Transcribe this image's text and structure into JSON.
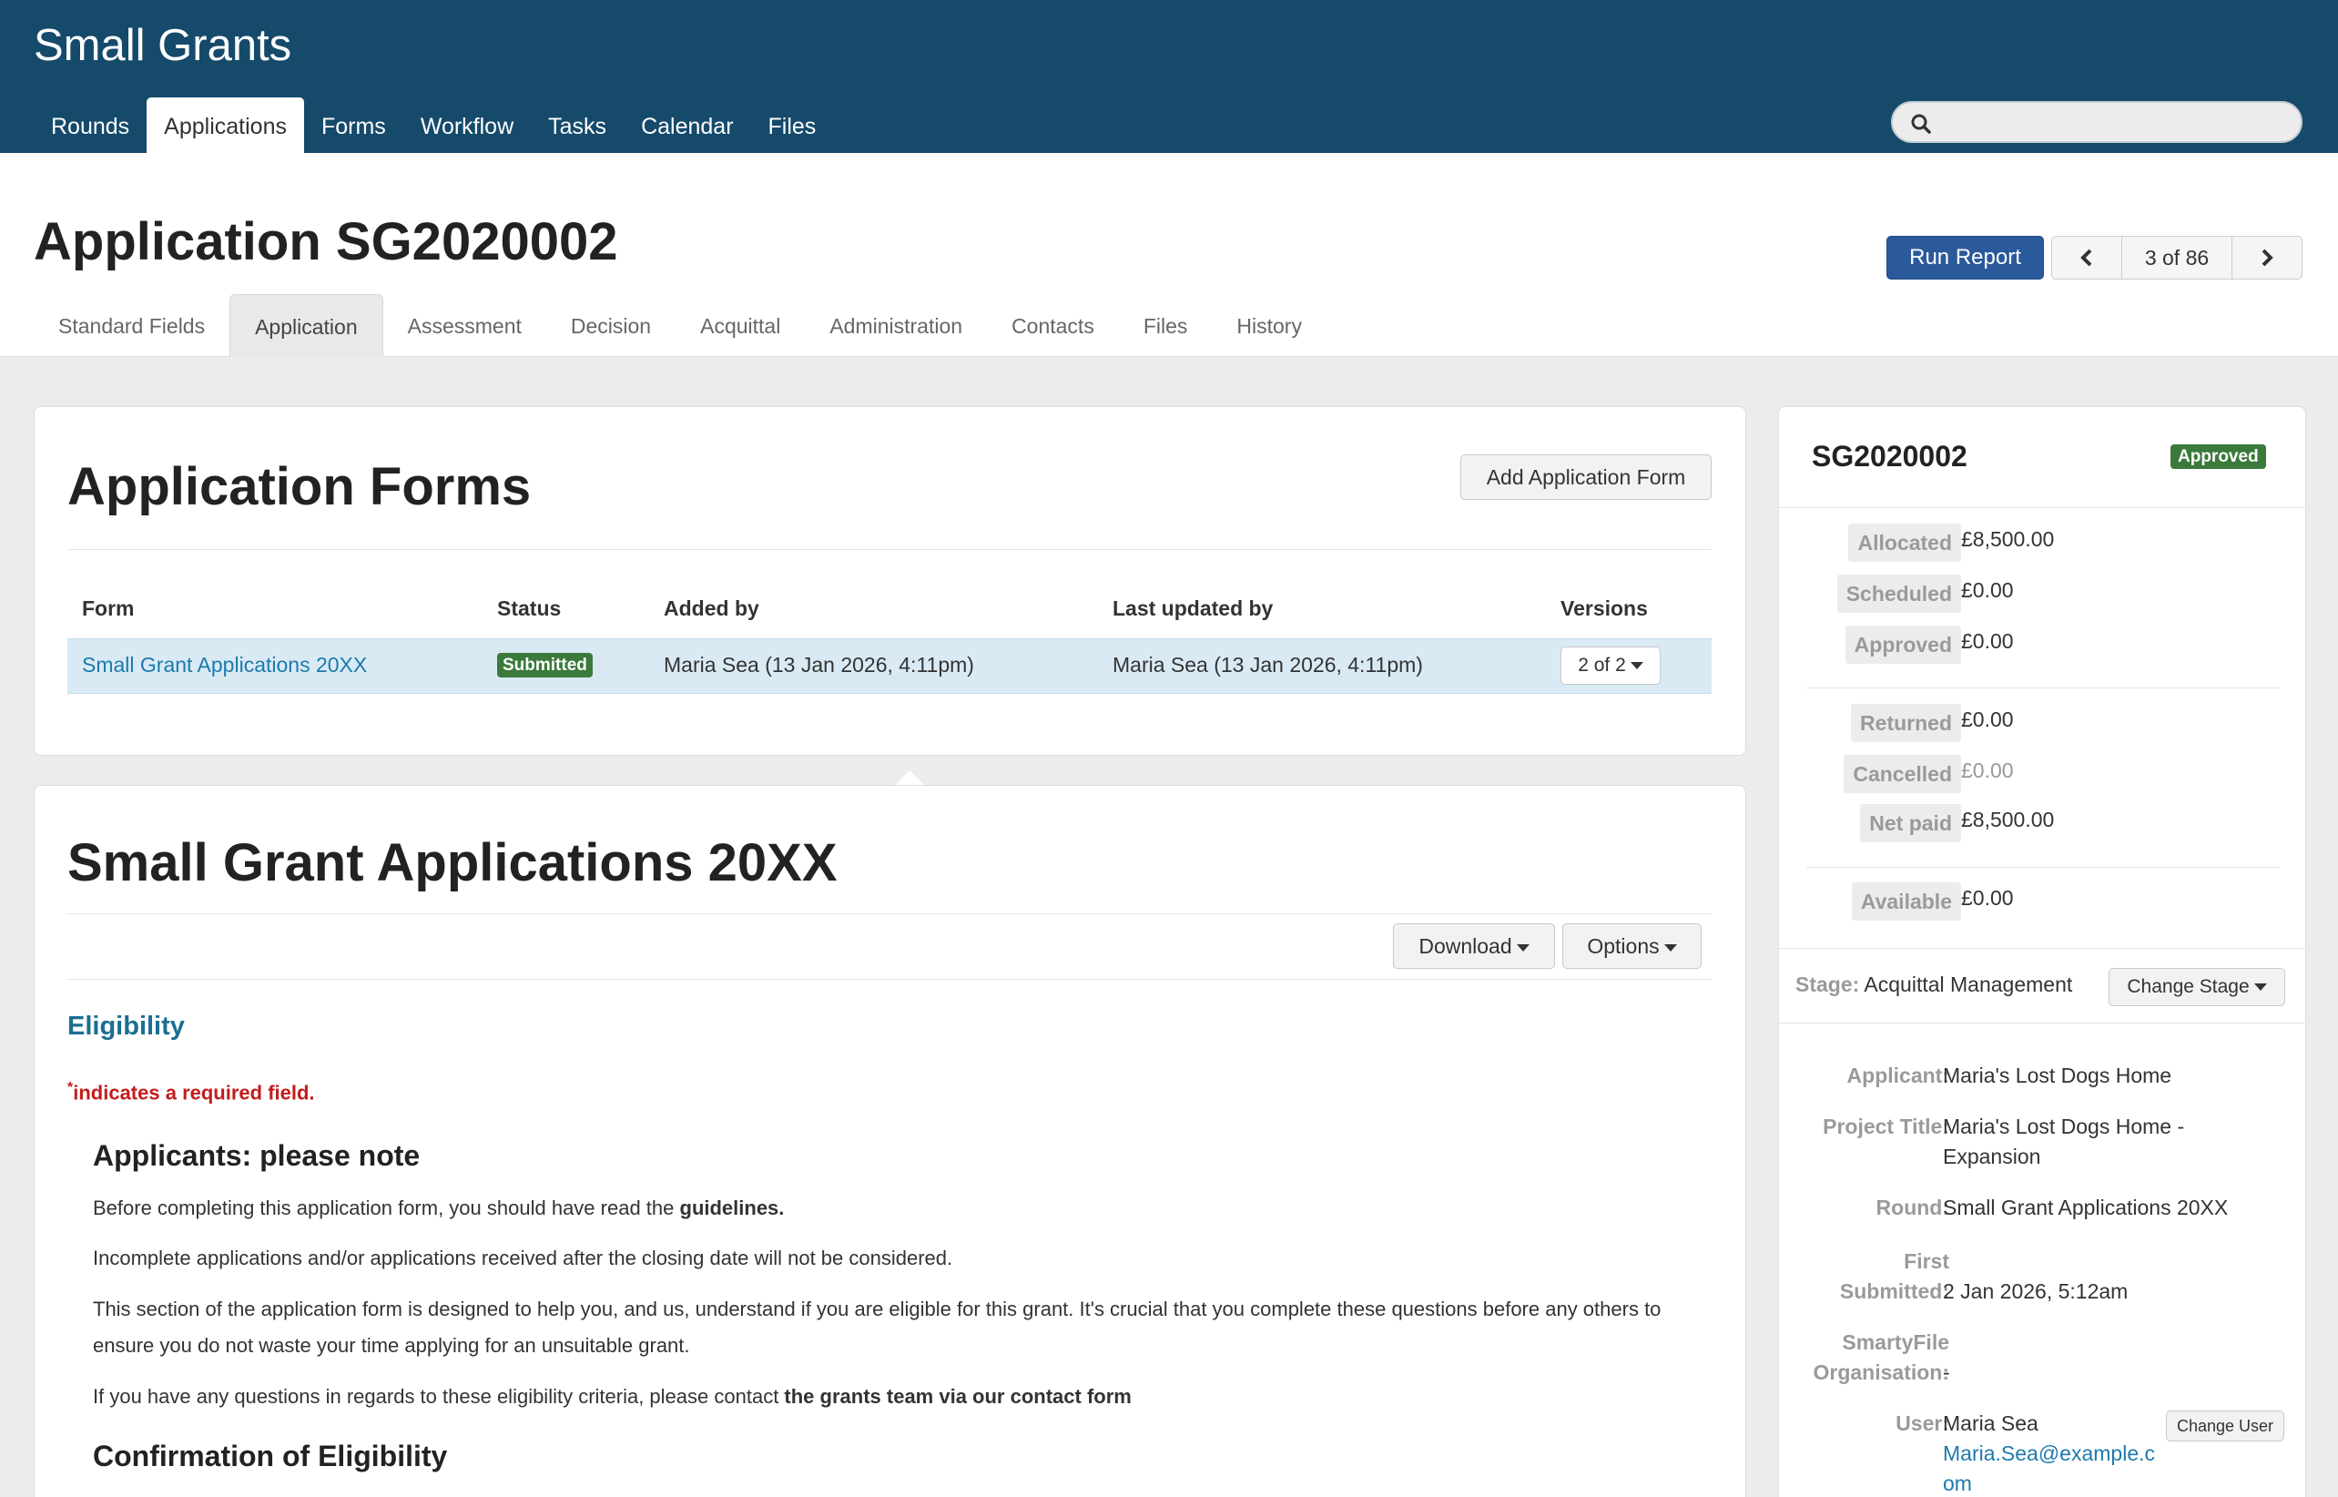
{
  "app": {
    "title": "Small Grants"
  },
  "nav": {
    "items": [
      "Rounds",
      "Applications",
      "Forms",
      "Workflow",
      "Tasks",
      "Calendar",
      "Files"
    ],
    "active": "Applications"
  },
  "search": {
    "placeholder": "",
    "icon": "search-icon"
  },
  "page": {
    "title": "Application SG2020002",
    "run_report": "Run Report",
    "pager": "3 of 86"
  },
  "tabs": {
    "items": [
      "Standard Fields",
      "Application",
      "Assessment",
      "Decision",
      "Acquittal",
      "Administration",
      "Contacts",
      "Files",
      "History"
    ],
    "active": "Application"
  },
  "forms_card": {
    "title": "Application Forms",
    "add_button": "Add Application Form",
    "columns": [
      "Form",
      "Status",
      "Added by",
      "Last updated by",
      "Versions"
    ],
    "rows": [
      {
        "form": "Small Grant Applications 20XX",
        "status": "Submitted",
        "added_by": "Maria Sea (13 Jan 2026, 4:11pm)",
        "updated_by": "Maria Sea (13 Jan 2026, 4:11pm)",
        "versions": "2 of 2"
      }
    ]
  },
  "form_detail": {
    "title": "Small Grant Applications 20XX",
    "download": "Download",
    "options": "Options",
    "section": "Eligibility",
    "required_marker": "*",
    "required_note": "indicates a required field.",
    "h_note": "Applicants: please note",
    "p1_a": "Before completing this application form, you should have read the ",
    "p1_b": "guidelines.",
    "p2": "Incomplete applications and/or applications received after the closing date will not be considered.",
    "p3": "This section of the application form is designed to help you, and us, understand if you are eligible for this grant. It's crucial that you complete these questions before any others to ensure you do not waste your time applying for an unsuitable grant.",
    "p4_a": "If you have any questions in regards to these eligibility criteria, please contact ",
    "p4_b": "the grants team via our contact form",
    "h_confirm": "Confirmation of Eligibility"
  },
  "sidebar": {
    "id": "SG2020002",
    "status": "Approved",
    "finance": [
      {
        "label": "Allocated",
        "value": "£8,500.00"
      },
      {
        "label": "Scheduled",
        "value": "£0.00"
      },
      {
        "label": "Approved",
        "value": "£0.00"
      },
      {
        "label": "Returned",
        "value": "£0.00"
      },
      {
        "label": "Cancelled",
        "value": "£0.00"
      },
      {
        "label": "Net paid",
        "value": "£8,500.00"
      },
      {
        "label": "Available",
        "value": "£0.00"
      }
    ],
    "stage_label": "Stage:",
    "stage_value": "Acquittal Management",
    "change_stage": "Change Stage",
    "details": {
      "applicant_label": "Applicant:",
      "applicant": "Maria's Lost Dogs Home",
      "project_label": "Project Title:",
      "project_l1": "Maria's Lost Dogs Home -",
      "project_l2": "Expansion",
      "round_label": "Round:",
      "round": "Small Grant Applications 20XX",
      "first_label_l1": "First",
      "first_label_l2": "Submitted:",
      "first": "2 Jan 2026, 5:12am",
      "org_label_l1": "SmartyFile",
      "org_label_l2": "Organisation:",
      "org": "-",
      "user_label": "User:",
      "user": "Maria Sea",
      "email_l1": "Maria.Sea@example.c",
      "email_l2": "om",
      "change_user": "Change User"
    }
  },
  "colors": {
    "topbar": "#154a6b",
    "primary": "#2a5a9c",
    "link": "#1d7aab",
    "success": "#3b7a3b",
    "danger": "#c31c1c",
    "row_highlight": "#d9eaf5"
  }
}
